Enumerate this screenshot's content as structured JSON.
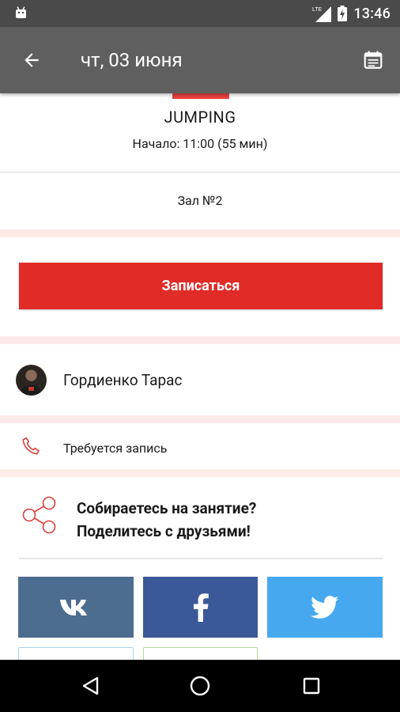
{
  "status_bar": {
    "time": "13:46",
    "network_label": "LTE",
    "icons": [
      "android-icon",
      "signal-icon",
      "battery-charging-icon"
    ]
  },
  "app_bar": {
    "title": "чт, 03 июня",
    "icons": [
      "back-arrow-icon",
      "calendar-icon"
    ]
  },
  "class_info": {
    "name": "JUMPING",
    "start": "Начало: 11:00 (55 мин)",
    "hall": "Зал №2",
    "accent_color": "#e8413f"
  },
  "signup": {
    "label": "Записаться",
    "color": "#e02b27"
  },
  "trainer": {
    "name": "Гордиенко Тарас"
  },
  "requirement": {
    "text": "Требуется запись",
    "icon": "phone-icon"
  },
  "share": {
    "line1": "Собираетесь на занятие?",
    "line2": "Поделитесь с друзьями!",
    "icon": "share-network-icon",
    "buttons": [
      {
        "name": "vk",
        "icon": "vk-icon",
        "color": "#4c6c90"
      },
      {
        "name": "facebook",
        "icon": "facebook-icon",
        "color": "#3b5998"
      },
      {
        "name": "twitter",
        "icon": "twitter-icon",
        "color": "#46a9f0"
      }
    ]
  },
  "nav_bar": {
    "icons": [
      "nav-back-icon",
      "nav-home-icon",
      "nav-recents-icon"
    ]
  }
}
